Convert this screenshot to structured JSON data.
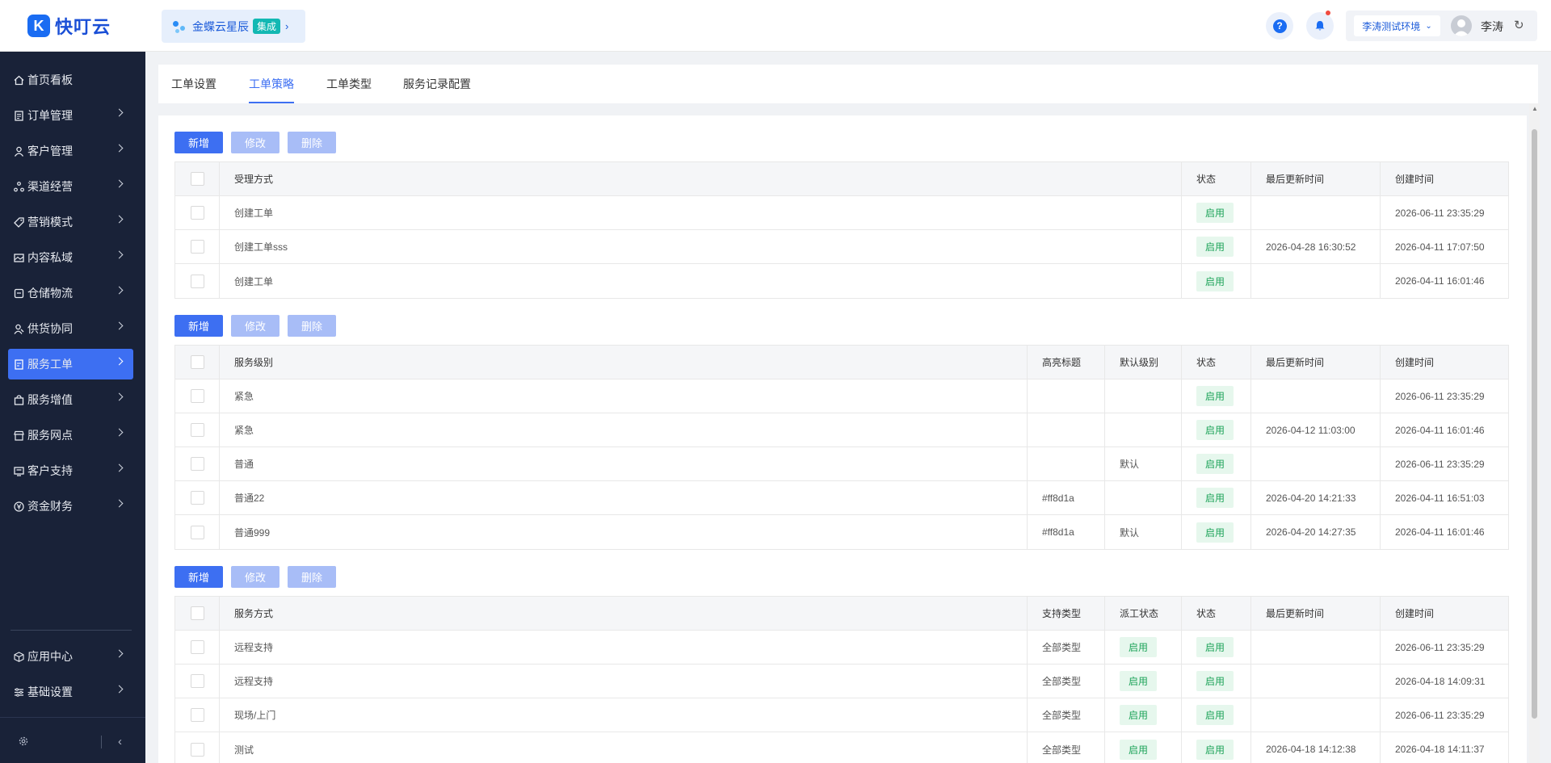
{
  "brand": {
    "logo_letter": "K",
    "name": "快叮云"
  },
  "app_switcher": {
    "label": "金蝶云星辰",
    "badge": "集成"
  },
  "header": {
    "help_label": "?",
    "environment": "李涛测试环境",
    "user_name": "李涛"
  },
  "sidebar": {
    "items": [
      {
        "label": "首页看板",
        "icon": "home-icon"
      },
      {
        "label": "订单管理",
        "icon": "order-icon"
      },
      {
        "label": "客户管理",
        "icon": "customer-icon"
      },
      {
        "label": "渠道经营",
        "icon": "channel-icon"
      },
      {
        "label": "营销模式",
        "icon": "tag-icon"
      },
      {
        "label": "内容私域",
        "icon": "image-icon"
      },
      {
        "label": "仓储物流",
        "icon": "warehouse-icon"
      },
      {
        "label": "供货协同",
        "icon": "supply-icon"
      },
      {
        "label": "服务工单",
        "icon": "ticket-icon",
        "active": true
      },
      {
        "label": "服务增值",
        "icon": "bag-icon"
      },
      {
        "label": "服务网点",
        "icon": "store-icon"
      },
      {
        "label": "客户支持",
        "icon": "support-icon"
      },
      {
        "label": "资金财务",
        "icon": "yuan-icon"
      }
    ],
    "bottom_items": [
      {
        "label": "应用中心",
        "icon": "cube-icon"
      },
      {
        "label": "基础设置",
        "icon": "settings-icon"
      }
    ]
  },
  "tabs": [
    {
      "label": "工单设置",
      "active": false
    },
    {
      "label": "工单策略",
      "active": true
    },
    {
      "label": "工单类型",
      "active": false
    },
    {
      "label": "服务记录配置",
      "active": false
    }
  ],
  "toolbar": {
    "add": "新增",
    "edit": "修改",
    "delete": "删除"
  },
  "accept_table": {
    "headers": [
      "受理方式",
      "状态",
      "最后更新时间",
      "创建时间"
    ],
    "rows": [
      [
        "创建工单",
        "启用",
        "",
        "2026-06-11 23:35:29"
      ],
      [
        "创建工单sss",
        "启用",
        "2026-04-28 16:30:52",
        "2026-04-11 17:07:50"
      ],
      [
        "创建工单",
        "启用",
        "",
        "2026-04-11 16:01:46"
      ]
    ]
  },
  "level_table": {
    "headers": [
      "服务级别",
      "高亮标题",
      "默认级别",
      "状态",
      "最后更新时间",
      "创建时间"
    ],
    "rows": [
      [
        "紧急",
        "",
        "",
        "启用",
        "",
        "2026-06-11 23:35:29"
      ],
      [
        "紧急",
        "",
        "",
        "启用",
        "2026-04-12 11:03:00",
        "2026-04-11 16:01:46"
      ],
      [
        "普通",
        "",
        "默认",
        "启用",
        "",
        "2026-06-11 23:35:29"
      ],
      [
        "普通22",
        "#ff8d1a",
        "",
        "启用",
        "2026-04-20 14:21:33",
        "2026-04-11 16:51:03"
      ],
      [
        "普通999",
        "#ff8d1a",
        "默认",
        "启用",
        "2026-04-20 14:27:35",
        "2026-04-11 16:01:46"
      ]
    ]
  },
  "method_table": {
    "headers": [
      "服务方式",
      "支持类型",
      "派工状态",
      "状态",
      "最后更新时间",
      "创建时间"
    ],
    "rows": [
      [
        "远程支持",
        "全部类型",
        "启用",
        "启用",
        "",
        "2026-06-11 23:35:29"
      ],
      [
        "远程支持",
        "全部类型",
        "启用",
        "启用",
        "",
        "2026-04-18 14:09:31"
      ],
      [
        "现场/上门",
        "全部类型",
        "启用",
        "启用",
        "",
        "2026-06-11 23:35:29"
      ],
      [
        "测试",
        "全部类型",
        "启用",
        "启用",
        "2026-04-18 14:12:38",
        "2026-04-18 14:11:37"
      ]
    ]
  },
  "colors": {
    "primary": "#3d6ff2",
    "sidebar_bg": "#192238",
    "tag_green": "#1ea45a",
    "tag_green_bg": "#e6f7ed"
  }
}
